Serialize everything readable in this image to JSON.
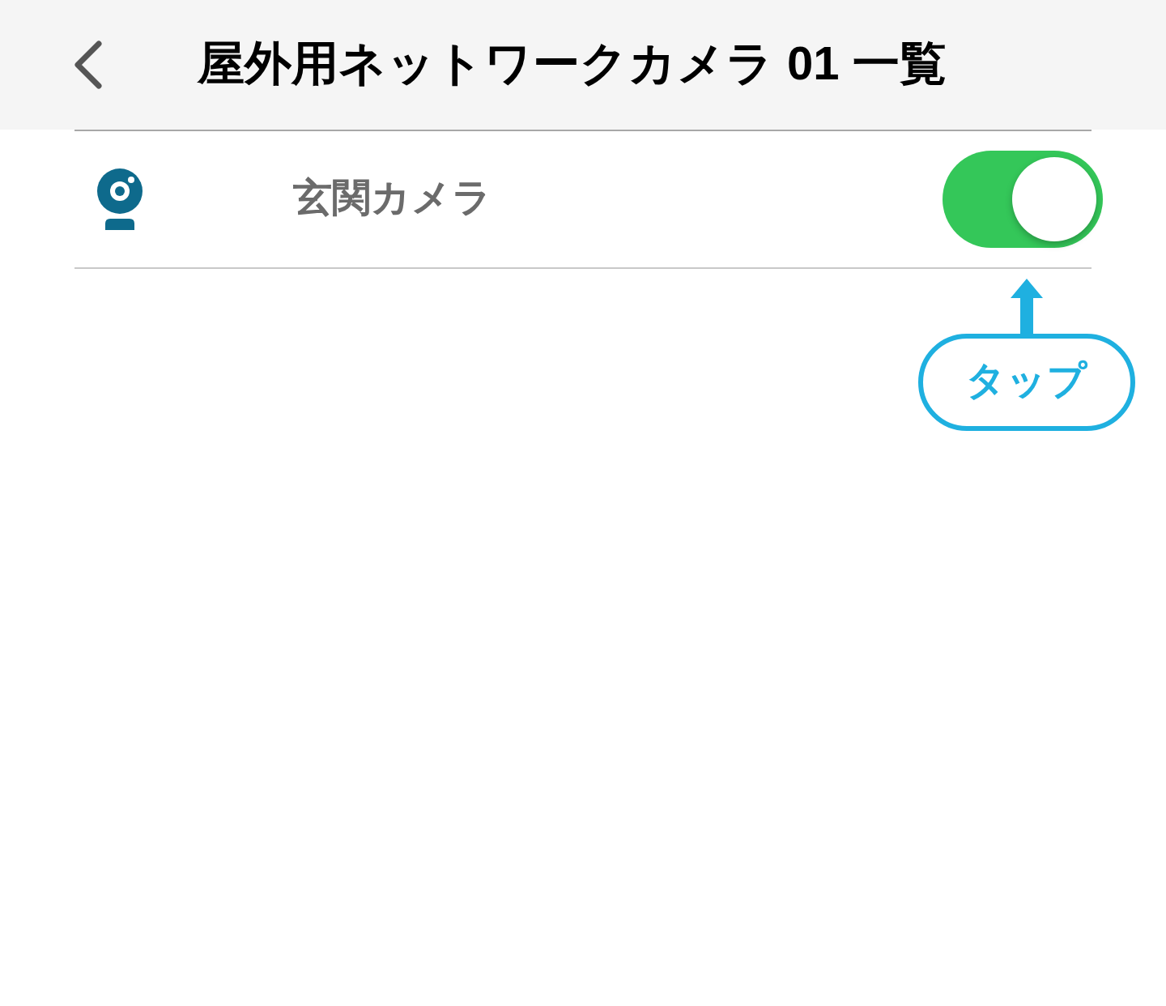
{
  "header": {
    "title": "屋外用ネットワークカメラ 01 一覧"
  },
  "cameras": [
    {
      "name": "玄関カメラ",
      "on": true
    }
  ],
  "callout": {
    "text": "タップ"
  }
}
